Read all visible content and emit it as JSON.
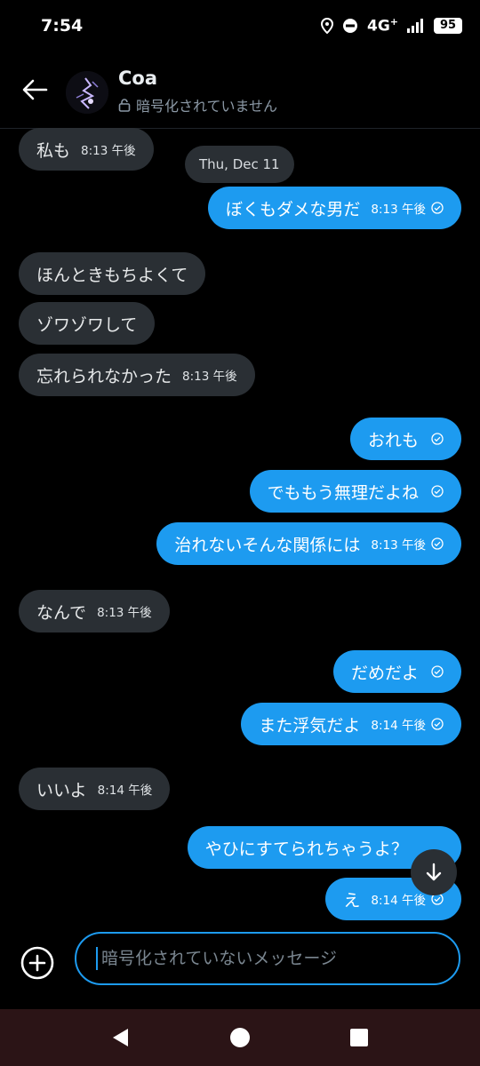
{
  "status_bar": {
    "time": "7:54",
    "network": "4G",
    "network_sup": "+",
    "battery": "95",
    "icons": [
      "location-icon",
      "do-not-disturb-icon",
      "signal-icon",
      "battery-icon"
    ]
  },
  "header": {
    "contact_name": "Coa",
    "subtitle": "暗号化されていません",
    "icons": [
      "back-arrow-icon",
      "avatar",
      "lock-icon"
    ]
  },
  "date_divider": "Thu, Dec 11",
  "messages": [
    {
      "dir": "in",
      "text": "私も",
      "time": "8:13 午後"
    },
    {
      "dir": "out",
      "text": "ぼくもダメな男だ",
      "time": "8:13 午後",
      "read": true
    },
    {
      "dir": "in",
      "text": "ほんときもちよくて",
      "time": ""
    },
    {
      "dir": "in",
      "text": "ゾワゾワして",
      "time": ""
    },
    {
      "dir": "in",
      "text": "忘れられなかった",
      "time": "8:13 午後"
    },
    {
      "dir": "out",
      "text": "おれも",
      "time": "",
      "read": true
    },
    {
      "dir": "out",
      "text": "でももう無理だよね",
      "time": "",
      "read": true
    },
    {
      "dir": "out",
      "text": "治れないそんな関係には",
      "time": "8:13 午後",
      "read": true
    },
    {
      "dir": "in",
      "text": "なんで",
      "time": "8:13 午後"
    },
    {
      "dir": "out",
      "text": "だめだよ",
      "time": "",
      "read": true
    },
    {
      "dir": "out",
      "text": "また浮気だよ",
      "time": "8:14 午後",
      "read": true
    },
    {
      "dir": "in",
      "text": "いいよ",
      "time": "8:14 午後"
    },
    {
      "dir": "out",
      "text": "やひにすてられちゃうよ？",
      "time": "",
      "read": false
    },
    {
      "dir": "out",
      "text": "え",
      "time": "8:14 午後",
      "read": true
    }
  ],
  "composer": {
    "placeholder": "暗号化されていないメッセージ",
    "value": ""
  },
  "colors": {
    "background": "#000000",
    "incoming_bubble": "#2a2f34",
    "outgoing_bubble": "#1d9bf0",
    "nav_bar": "#2b1416"
  }
}
